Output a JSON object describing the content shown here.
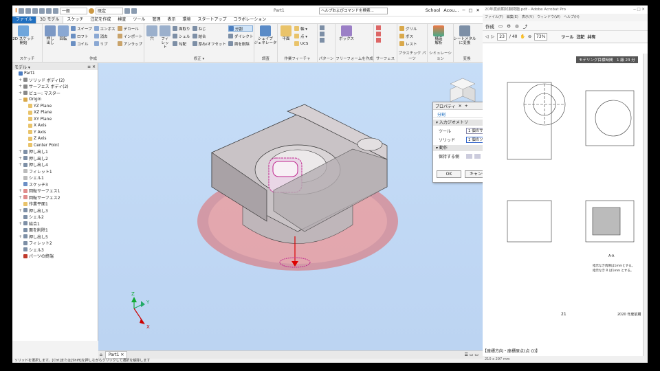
{
  "inventor": {
    "qat": {
      "style_value": "一般",
      "display_value": "既定",
      "title": "Part1",
      "search_placeholder": "ヘルプおよびコマンドを検索...",
      "school": "School",
      "account": "Acou..."
    },
    "tabs": [
      "ファイル",
      "3D モデル",
      "スケッチ",
      "注記を作成",
      "検査",
      "ツール",
      "管理",
      "表示",
      "環境",
      "スタートアップ",
      "コラボレーション"
    ],
    "active_tab": "3D モデル",
    "ribbon": {
      "sketch": {
        "label": "スケッチ",
        "buttons": [
          "2D スケッチ\n開始"
        ]
      },
      "create": {
        "label": "作成",
        "big": [
          "押し出し",
          "回転"
        ],
        "small": [
          "スイープ",
          "ロフト",
          "コイル",
          "エンボス",
          "消去",
          "リブ",
          "デカール",
          "インポート",
          "アンラップ"
        ]
      },
      "modify": {
        "label": "修正 ▾",
        "big": [
          "穴",
          "フィレット"
        ],
        "small": [
          "面取り",
          "シェル",
          "勾配",
          "ねじ",
          "結合",
          "厚み/オフセット",
          "分割",
          "ダイレクト",
          "面を削除"
        ]
      },
      "explore": {
        "label": "調査",
        "buttons": [
          "シェイプ\nジェネレータ"
        ]
      },
      "work": {
        "label": "作業フィーチャ",
        "big": [
          "平面"
        ],
        "small": [
          "軸 ▾",
          "点 ▾",
          "UCS"
        ]
      },
      "pattern": {
        "label": "パターン"
      },
      "freeform": {
        "label": "フリーフォームを作成",
        "buttons": [
          "ボックス"
        ]
      },
      "surface": {
        "label": "サーフェス"
      },
      "plastic": {
        "label": "プラスチック パーツ",
        "small": [
          "グリル",
          "ボス",
          "レスト"
        ]
      },
      "sim": {
        "label": "シミュレーション",
        "buttons": [
          "構造\n解析"
        ]
      },
      "convert": {
        "label": "変換",
        "buttons": [
          "シートメタル\nに変換"
        ]
      }
    },
    "browser": {
      "title": "モデル ▾",
      "items": [
        {
          "t": "Part1",
          "e": "",
          "l": 0,
          "c": "#4a7bc0"
        },
        {
          "t": "ソリッド ボディ(2)",
          "e": "+",
          "l": 1,
          "c": "#888"
        },
        {
          "t": "サーフェス ボディ(2)",
          "e": "+",
          "l": 1,
          "c": "#888"
        },
        {
          "t": "ビュー: マスター",
          "e": "+",
          "l": 1,
          "c": "#888"
        },
        {
          "t": "Origin",
          "e": "−",
          "l": 1,
          "c": "#d9a84a"
        },
        {
          "t": "YZ Plane",
          "e": "",
          "l": 2,
          "c": "#e9c36a"
        },
        {
          "t": "XZ Plane",
          "e": "",
          "l": 2,
          "c": "#e9c36a"
        },
        {
          "t": "XY Plane",
          "e": "",
          "l": 2,
          "c": "#e9c36a"
        },
        {
          "t": "X Axis",
          "e": "",
          "l": 2,
          "c": "#e9c36a"
        },
        {
          "t": "Y Axis",
          "e": "",
          "l": 2,
          "c": "#e9c36a"
        },
        {
          "t": "Z Axis",
          "e": "",
          "l": 2,
          "c": "#e9c36a"
        },
        {
          "t": "Center Point",
          "e": "",
          "l": 2,
          "c": "#e9c36a"
        },
        {
          "t": "押し出し1",
          "e": "+",
          "l": 1,
          "c": "#7d8fa6"
        },
        {
          "t": "押し出し2",
          "e": "+",
          "l": 1,
          "c": "#7d8fa6"
        },
        {
          "t": "押し出し4",
          "e": "+",
          "l": 1,
          "c": "#7d8fa6"
        },
        {
          "t": "フィレット1",
          "e": "",
          "l": 1,
          "c": "#bbb"
        },
        {
          "t": "シェル1",
          "e": "",
          "l": 1,
          "c": "#bbb"
        },
        {
          "t": "スケッチ3",
          "e": "",
          "l": 1,
          "c": "#6b8fc6"
        },
        {
          "t": "回転サーフェス1",
          "e": "+",
          "l": 1,
          "c": "#e08c8c"
        },
        {
          "t": "回転サーフェス2",
          "e": "+",
          "l": 1,
          "c": "#e08c8c"
        },
        {
          "t": "作業平面1",
          "e": "",
          "l": 1,
          "c": "#e9c36a"
        },
        {
          "t": "押し出し3",
          "e": "+",
          "l": 1,
          "c": "#7d8fa6"
        },
        {
          "t": "シェル2",
          "e": "",
          "l": 1,
          "c": "#7d8fa6"
        },
        {
          "t": "結合1",
          "e": "+",
          "l": 1,
          "c": "#7d8fa6"
        },
        {
          "t": "面を削除1",
          "e": "",
          "l": 1,
          "c": "#7d8fa6"
        },
        {
          "t": "押し出し5",
          "e": "+",
          "l": 1,
          "c": "#7d8fa6"
        },
        {
          "t": "フィレット2",
          "e": "",
          "l": 1,
          "c": "#7d8fa6"
        },
        {
          "t": "シェル3",
          "e": "",
          "l": 1,
          "c": "#7d8fa6"
        },
        {
          "t": "パーツの終端",
          "e": "",
          "l": 1,
          "c": "#c0392b"
        }
      ]
    },
    "properties": {
      "title": "プロパティ",
      "tab": "分割",
      "section_input": "入力ジオメトリ",
      "tool_label": "ツール",
      "tool_value": "1 個のサーフェス",
      "solid_label": "ソリッド",
      "solid_value": "1 個のソ",
      "section_action": "動作",
      "keep_label": "保持する側",
      "ok": "OK",
      "cancel": "キャンセル"
    },
    "doc_tab": "Part1",
    "status": "ソリッドを選択します。[Ctrl]または[Shift]を押しながらクリックして選択を解除します"
  },
  "acrobat": {
    "title": "20年度前期試験問題.pdf - Adobe Acrobat Pro",
    "menu": "ファイル(F)　編集(E)　表示(V)　ウィンドウ(W)　ヘルプ(H)",
    "create": "作成",
    "page_current": "23",
    "page_total": "/ 40",
    "zoom": "73%",
    "tools": "ツール",
    "comment": "注記",
    "share": "共有",
    "header": "モデリング目標時間　1 級 23 分",
    "section_label": "A-A",
    "note_lines": [
      "指示なき肉厚は1mmとする。",
      "指示なき R は1mm とする。"
    ],
    "page_num": "21",
    "exam": "2020 年度前期",
    "footer_note": "【座標方向・座標原点(点 O)】",
    "page_size": "210 x 297 mm"
  }
}
